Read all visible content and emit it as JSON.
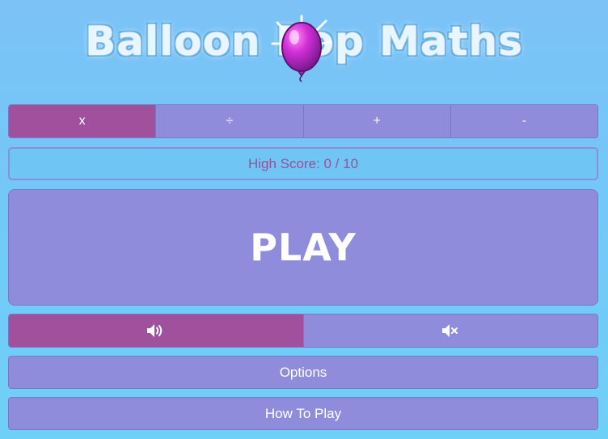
{
  "title": "Balloon Pop Maths",
  "operations": [
    {
      "label": "x",
      "active": true
    },
    {
      "label": "÷",
      "active": false
    },
    {
      "label": "+",
      "active": false
    },
    {
      "label": "-",
      "active": false
    }
  ],
  "high_score": {
    "text": "High Score: 0 / 10"
  },
  "play_label": "PLAY",
  "sound": {
    "on_icon": "speaker-on-icon",
    "off_icon": "speaker-mute-icon",
    "active": "on"
  },
  "menu": {
    "options_label": "Options",
    "how_to_play_label": "How To Play"
  },
  "colors": {
    "background": "#72c8f7",
    "button": "#8f8ddb",
    "active": "#a1509d",
    "high_score_text": "#9a4f98"
  }
}
